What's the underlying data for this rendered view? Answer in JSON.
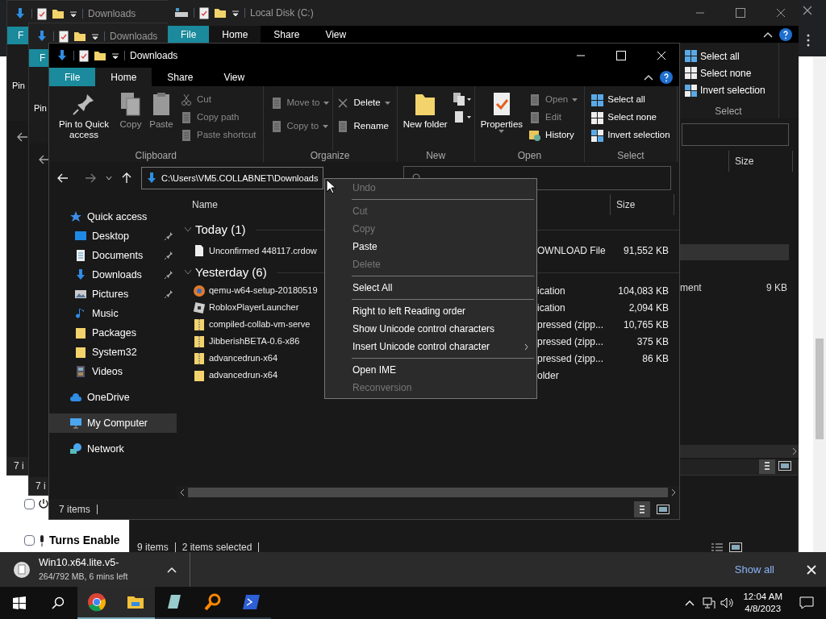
{
  "browser": {
    "checkbox_rows": [
      {
        "checked": false
      },
      {
        "label": "Turns Enable",
        "checked": false
      }
    ]
  },
  "status_window": {
    "status": [
      "9 items",
      "2 items selected"
    ]
  },
  "back_windows": [
    {
      "title": "Downloads",
      "file_tab": "F",
      "ribbon_label": "Pin",
      "status": "7 i"
    },
    {
      "title": "Downloads",
      "file_tab": "F",
      "ribbon_label": "Pin",
      "status": "7 i"
    }
  ],
  "local_disk_window": {
    "title": "Local Disk (C:)",
    "tabs": [
      {
        "label": "File",
        "selected": false
      },
      {
        "label": "Home",
        "selected": true
      },
      {
        "label": "Share",
        "selected": false
      },
      {
        "label": "View",
        "selected": false
      }
    ],
    "select_group": {
      "label": "Select",
      "items": [
        "Select all",
        "Select none",
        "Invert selection"
      ]
    },
    "column": "Size",
    "row": {
      "type": "ment",
      "size": "9 KB",
      "selected": false
    }
  },
  "window": {
    "title": "Downloads",
    "tabs": [
      {
        "label": "File",
        "selected": false
      },
      {
        "label": "Home",
        "selected": true
      },
      {
        "label": "Share",
        "selected": false
      },
      {
        "label": "View",
        "selected": false
      }
    ],
    "ribbon": [
      {
        "kind": "clipboard",
        "label": "Clipboard",
        "large": [
          {
            "label": "Pin to Quick access",
            "disabled": false
          },
          {
            "label": "Copy",
            "disabled": true
          },
          {
            "label": "Paste",
            "disabled": true
          }
        ],
        "small": [
          {
            "label": "Cut",
            "disabled": true,
            "dropdown": false
          },
          {
            "label": "Copy path",
            "disabled": true,
            "dropdown": false
          },
          {
            "label": "Paste shortcut",
            "disabled": true,
            "dropdown": false
          }
        ]
      },
      {
        "kind": "organize",
        "label": "Organize",
        "small": [
          {
            "label": "Move to",
            "disabled": true,
            "dropdown": true
          },
          {
            "label": "Copy to",
            "disabled": true,
            "dropdown": true
          },
          {
            "label": "Delete",
            "disabled": false,
            "dropdown": true
          },
          {
            "label": "Rename",
            "disabled": false,
            "dropdown": false
          }
        ]
      },
      {
        "kind": "new",
        "label": "New",
        "large": [
          {
            "label": "New folder",
            "disabled": false
          }
        ]
      },
      {
        "kind": "open",
        "label": "Open",
        "large": [
          {
            "label": "Properties",
            "disabled": false,
            "dropdown": true
          }
        ],
        "small": [
          {
            "label": "Open",
            "disabled": true,
            "dropdown": true
          },
          {
            "label": "Edit",
            "disabled": true,
            "dropdown": false
          },
          {
            "label": "History",
            "disabled": false,
            "dropdown": false
          }
        ]
      },
      {
        "kind": "select",
        "label": "Select",
        "small": [
          {
            "label": "Select all",
            "disabled": false,
            "dropdown": false
          },
          {
            "label": "Select none",
            "disabled": false,
            "dropdown": false
          },
          {
            "label": "Invert selection",
            "disabled": false,
            "dropdown": false
          }
        ]
      }
    ],
    "address": "C:\\Users\\VM5.COLLABNET\\Downloads",
    "nav": [
      {
        "label": "Quick access",
        "selected": false,
        "children": [
          {
            "label": "Desktop",
            "pinned": true,
            "selected": false
          },
          {
            "label": "Documents",
            "pinned": true,
            "selected": false
          },
          {
            "label": "Downloads",
            "pinned": true,
            "selected": false
          },
          {
            "label": "Pictures",
            "pinned": true,
            "selected": false
          },
          {
            "label": "Music",
            "pinned": false,
            "selected": false
          },
          {
            "label": "Packages",
            "pinned": false,
            "selected": false
          },
          {
            "label": "System32",
            "pinned": false,
            "selected": false
          },
          {
            "label": "Videos",
            "pinned": false,
            "selected": false
          }
        ]
      },
      {
        "label": "OneDrive",
        "selected": false
      },
      {
        "label": "My Computer",
        "selected": true
      },
      {
        "label": "Network",
        "selected": false
      }
    ],
    "columns": [
      "Name",
      "Size"
    ],
    "groups": [
      {
        "label": "Today (1)",
        "expanded": true,
        "rows": [
          {
            "kind": "file",
            "name": "Unconfirmed 448117.crdow",
            "type": "OWNLOAD File",
            "size": "91,552 KB"
          }
        ]
      },
      {
        "label": "Yesterday (6)",
        "expanded": true,
        "rows": [
          {
            "kind": "installer",
            "name": "qemu-w64-setup-20180519",
            "type": "ication",
            "size": "104,083 KB"
          },
          {
            "kind": "app",
            "name": "RobloxPlayerLauncher",
            "type": "ication",
            "size": "2,094 KB"
          },
          {
            "kind": "zip",
            "name": "compiled-collab-vm-serve",
            "type": "pressed (zipp...",
            "size": "10,765 KB"
          },
          {
            "kind": "zip",
            "name": "JibberishBETA-0.6-x86",
            "type": "pressed (zipp...",
            "size": "375 KB"
          },
          {
            "kind": "zip",
            "name": "advancedrun-x64",
            "type": "pressed (zipp...",
            "size": "86 KB"
          },
          {
            "kind": "folder",
            "name": "advancedrun-x64",
            "type": "older"
          }
        ]
      }
    ],
    "status": "7 items"
  },
  "context_menu": [
    {
      "kind": "item",
      "label": "Undo",
      "disabled": true,
      "submenu": false
    },
    {
      "kind": "separator"
    },
    {
      "kind": "item",
      "label": "Cut",
      "disabled": true,
      "submenu": false
    },
    {
      "kind": "item",
      "label": "Copy",
      "disabled": true,
      "submenu": false
    },
    {
      "kind": "item",
      "label": "Paste",
      "disabled": false,
      "submenu": false
    },
    {
      "kind": "item",
      "label": "Delete",
      "disabled": true,
      "submenu": false
    },
    {
      "kind": "separator"
    },
    {
      "kind": "item",
      "label": "Select All",
      "disabled": false,
      "submenu": false
    },
    {
      "kind": "separator"
    },
    {
      "kind": "item",
      "label": "Right to left Reading order",
      "disabled": false,
      "submenu": false
    },
    {
      "kind": "item",
      "label": "Show Unicode control characters",
      "disabled": false,
      "submenu": false
    },
    {
      "kind": "item",
      "label": "Insert Unicode control character",
      "disabled": false,
      "submenu": true
    },
    {
      "kind": "separator"
    },
    {
      "kind": "item",
      "label": "Open IME",
      "disabled": false,
      "submenu": false
    },
    {
      "kind": "item",
      "label": "Reconversion",
      "disabled": true,
      "submenu": false
    }
  ],
  "download_bar": {
    "file": "Win10.x64.lite.v5-",
    "progress": "264/792 MB, 6 mins left",
    "show_all": "Show all"
  },
  "taskbar": {
    "apps": [
      {
        "kind": "chrome",
        "active": true
      },
      {
        "kind": "explorer",
        "active": true
      },
      {
        "kind": "notepad",
        "active": false
      },
      {
        "kind": "search-app",
        "active": false
      },
      {
        "kind": "powershell",
        "active": false
      }
    ],
    "time": "12:04 AM",
    "date": "4/8/2023"
  }
}
